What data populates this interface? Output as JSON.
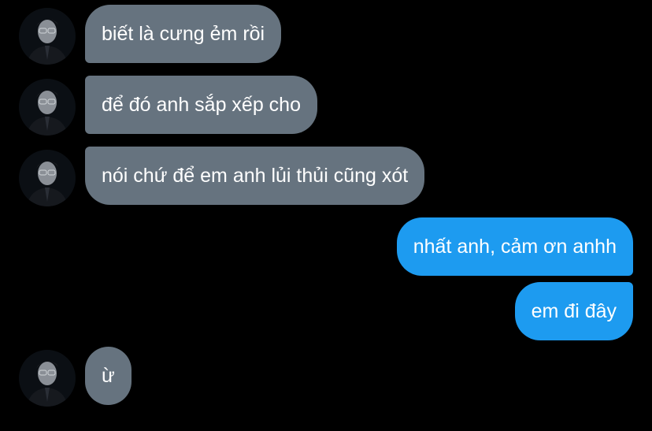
{
  "conversation": {
    "contact_avatar": "profile-photo-man-with-glasses",
    "colors": {
      "background": "#000000",
      "incoming_bubble": "#66737f",
      "outgoing_bubble": "#1d9bf0",
      "text": "#ffffff"
    },
    "messages": [
      {
        "direction": "incoming",
        "text": "biết là cưng ẻm rồi"
      },
      {
        "direction": "incoming",
        "text": "để đó anh sắp xếp cho"
      },
      {
        "direction": "incoming",
        "text": "nói chứ để em anh lủi thủi cũng xót"
      },
      {
        "direction": "outgoing",
        "text": "nhất anh, cảm ơn anhh"
      },
      {
        "direction": "outgoing",
        "text": "em đi đây"
      },
      {
        "direction": "incoming",
        "text": "ừ"
      }
    ]
  }
}
